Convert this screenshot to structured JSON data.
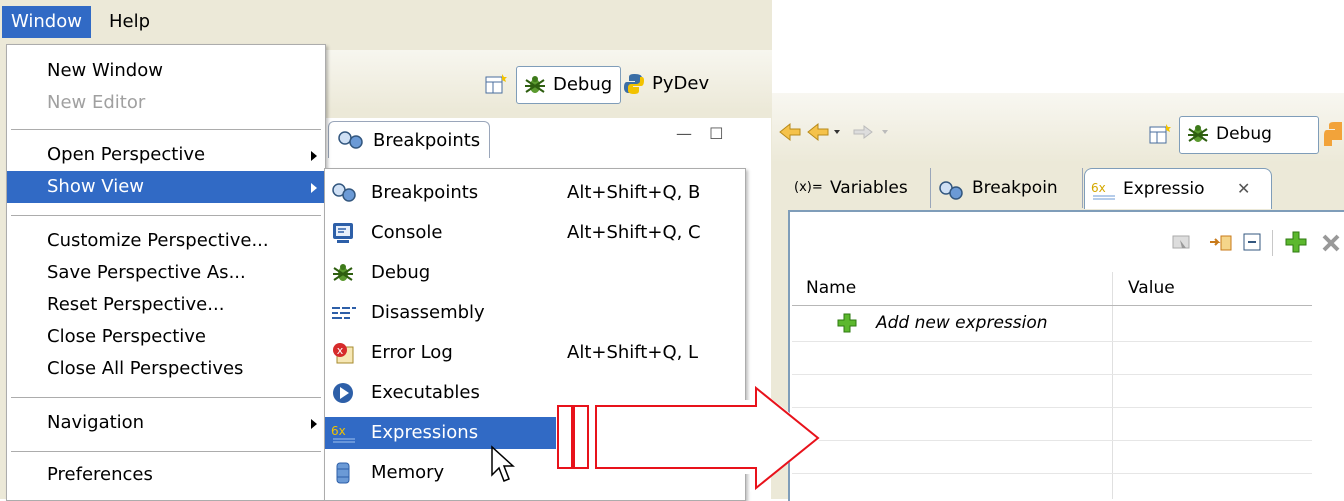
{
  "menubar": {
    "items": [
      "Window",
      "Help"
    ]
  },
  "left_window": {
    "perspectives": [
      "Debug",
      "PyDev"
    ],
    "breakpoints_tab": "Breakpoints",
    "view_buttons": [
      "—",
      "☐"
    ]
  },
  "window_menu": {
    "items": [
      {
        "label": "New Window"
      },
      {
        "label": "New Editor"
      },
      {
        "label": "Open Perspective"
      },
      {
        "label": "Show View"
      },
      {
        "label": "Customize Perspective..."
      },
      {
        "label": "Save Perspective As..."
      },
      {
        "label": "Reset Perspective..."
      },
      {
        "label": "Close Perspective"
      },
      {
        "label": "Close All Perspectives"
      },
      {
        "label": "Navigation"
      },
      {
        "label": "Preferences"
      }
    ]
  },
  "show_view_menu": {
    "items": [
      {
        "label": "Breakpoints",
        "shortcut": "Alt+Shift+Q, B",
        "icon": "breakpoints-icon"
      },
      {
        "label": "Console",
        "shortcut": "Alt+Shift+Q, C",
        "icon": "console-icon"
      },
      {
        "label": "Debug",
        "shortcut": "",
        "icon": "debug-bug-icon"
      },
      {
        "label": "Disassembly",
        "shortcut": "",
        "icon": "disassembly-icon"
      },
      {
        "label": "Error Log",
        "shortcut": "Alt+Shift+Q, L",
        "icon": "error-log-icon"
      },
      {
        "label": "Executables",
        "shortcut": "",
        "icon": "executables-icon"
      },
      {
        "label": "Expressions",
        "shortcut": "",
        "icon": "expressions-icon"
      },
      {
        "label": "Memory",
        "shortcut": "",
        "icon": "memory-icon"
      }
    ]
  },
  "right_window": {
    "perspective": "Debug",
    "tabs": [
      {
        "label": "Variables",
        "prefix": "(x)="
      },
      {
        "label": "Breakpoin"
      },
      {
        "label": "Expressio"
      }
    ],
    "table": {
      "columns": [
        "Name",
        "Value"
      ],
      "add_row": "Add new expression"
    }
  },
  "colors": {
    "highlight": "#316ac5",
    "window_bg": "#ece9d8",
    "arrow": "#e8121b"
  }
}
